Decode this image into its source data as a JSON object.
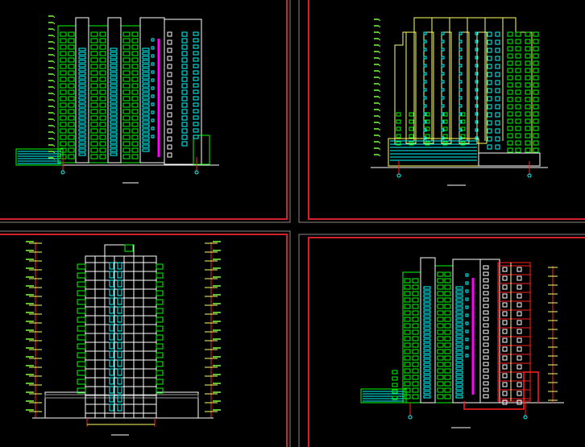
{
  "drawing": {
    "background": "#000000",
    "colors": {
      "frame_border": "#d4202a",
      "frame_border_inner": "#b01820",
      "frame_white": "#e8e8e8",
      "green": "#00ff00",
      "lime": "#7cff3c",
      "cyan": "#00ffff",
      "white": "#ffffff",
      "yellow": "#ffff66",
      "magenta": "#ff00ff",
      "red": "#ff2020",
      "grey": "#9a9a9a"
    },
    "panels": [
      {
        "id": "panel-north-elevation",
        "caption": ""
      },
      {
        "id": "panel-south-elevation",
        "caption": ""
      },
      {
        "id": "panel-section",
        "caption": ""
      },
      {
        "id": "panel-east-elevation",
        "caption": ""
      }
    ]
  }
}
